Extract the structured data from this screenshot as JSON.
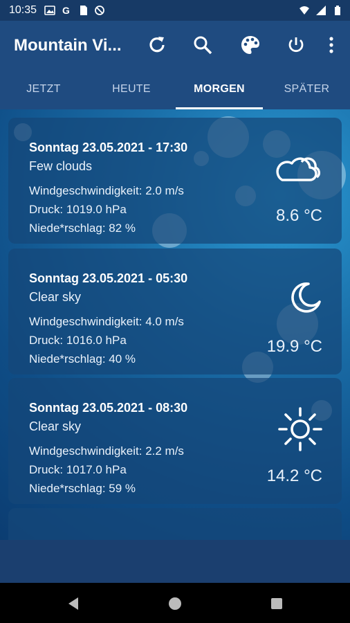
{
  "status": {
    "time": "10:35"
  },
  "app": {
    "title": "Mountain Vi..."
  },
  "tabs": [
    {
      "label": "JETZT"
    },
    {
      "label": "HEUTE"
    },
    {
      "label": "MORGEN"
    },
    {
      "label": "SPÄTER"
    }
  ],
  "cards": [
    {
      "date": "Sonntag 23.05.2021 - 17:30",
      "desc": "Few clouds",
      "wind": "Windgeschwindigkeit: 2.0 m/s",
      "pressure": "Druck: 1019.0 hPa",
      "precip": "Niede*rschlag: 82 %",
      "temp": "8.6 °C",
      "icon": "cloudy-icon"
    },
    {
      "date": "Sonntag 23.05.2021 - 05:30",
      "desc": "Clear sky",
      "wind": "Windgeschwindigkeit: 4.0 m/s",
      "pressure": "Druck: 1016.0 hPa",
      "precip": "Niede*rschlag: 40 %",
      "temp": "19.9 °C",
      "icon": "moon-icon"
    },
    {
      "date": "Sonntag 23.05.2021 - 08:30",
      "desc": "Clear sky",
      "wind": "Windgeschwindigkeit: 2.2 m/s",
      "pressure": "Druck: 1017.0 hPa",
      "precip": "Niede*rschlag: 59 %",
      "temp": "14.2 °C",
      "icon": "sun-icon"
    }
  ],
  "colors": {
    "appbar": "#1f4b80",
    "statusbar": "#173a66",
    "accent": "#ffffff"
  }
}
